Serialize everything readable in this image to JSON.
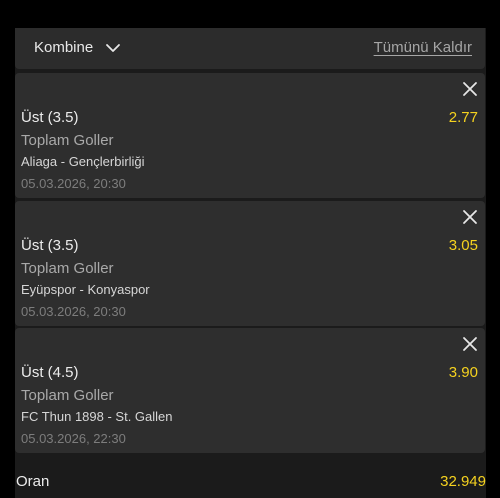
{
  "header": {
    "mode_label": "Kombine",
    "clear_all_label": "Tümünü Kaldır",
    "chevron_icon": "chevron-down-icon"
  },
  "bets": [
    {
      "selection": "Üst (3.5)",
      "odds": "2.77",
      "market": "Toplam Goller",
      "match": "Aliaga - Gençlerbirliği",
      "datetime": "05.03.2026, 20:30"
    },
    {
      "selection": "Üst (3.5)",
      "odds": "3.05",
      "market": "Toplam Goller",
      "match": "Eyüpspor - Konyaspor",
      "datetime": "05.03.2026, 20:30"
    },
    {
      "selection": "Üst (4.5)",
      "odds": "3.90",
      "market": "Toplam Goller",
      "match": "FC Thun 1898 - St. Gallen",
      "datetime": "05.03.2026, 22:30"
    }
  ],
  "footer": {
    "total_label": "Oran",
    "total_value": "32.949"
  },
  "colors": {
    "background": "#000000",
    "panel": "#1b1b1b",
    "card": "#2e2e2e",
    "odds_accent": "#f5d21f"
  }
}
